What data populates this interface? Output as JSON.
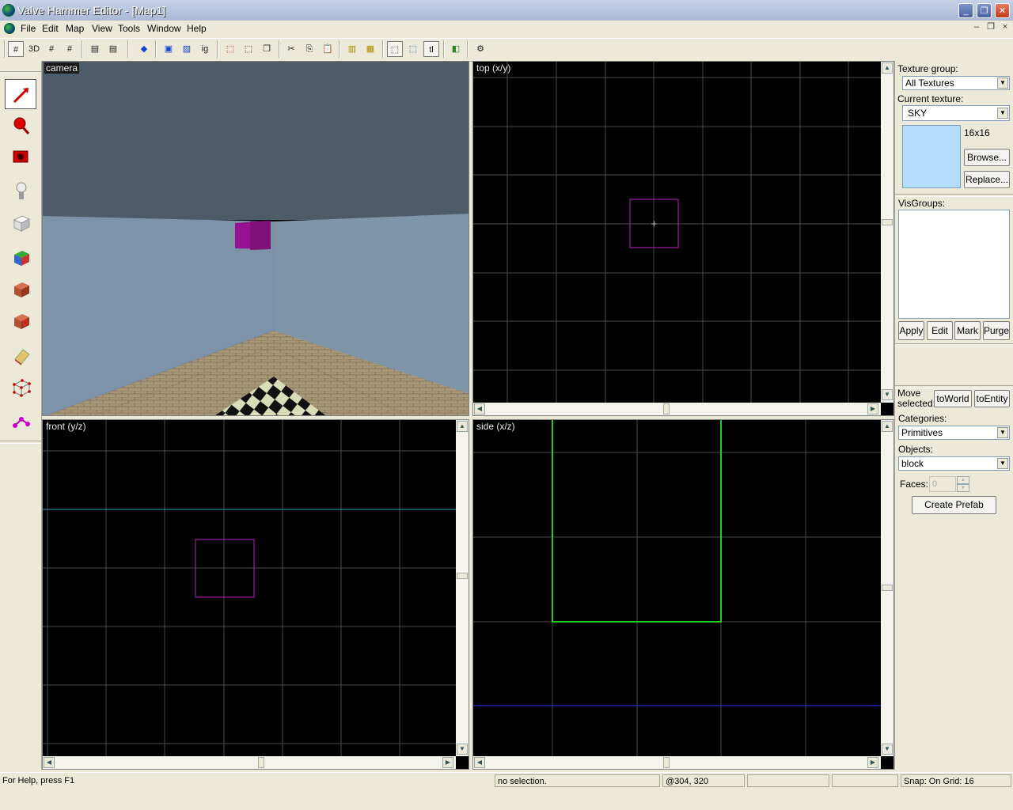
{
  "window": {
    "title": "Valve Hammer Editor - [Map1]",
    "minimize_glyph": "_",
    "restore_glyph": "❐",
    "close_glyph": "✕"
  },
  "menu": [
    "File",
    "Edit",
    "Map",
    "View",
    "Tools",
    "Window",
    "Help"
  ],
  "mdi_controls": [
    "–",
    "❐",
    "×"
  ],
  "toolbar": {
    "texture_lock_label": "tl",
    "group_ignore_label": "ig"
  },
  "viewports": {
    "camera": {
      "label": "camera"
    },
    "top": {
      "label": "top (x/y)"
    },
    "front": {
      "label": "front (y/z)"
    },
    "side": {
      "label": "side (x/z)"
    }
  },
  "right_panel": {
    "texture_group_label": "Texture group:",
    "texture_group_value": "All Textures",
    "current_texture_label": "Current texture:",
    "current_texture_value": "SKY",
    "texture_size": "16x16",
    "texture_preview_color": "#b6dcff",
    "browse": "Browse...",
    "replace": "Replace...",
    "visgroups_label": "VisGroups:",
    "apply": "Apply",
    "edit": "Edit",
    "mark": "Mark",
    "purge": "Purge",
    "move_selected": "Move selected:",
    "to_world": "toWorld",
    "to_entity": "toEntity",
    "categories_label": "Categories:",
    "categories_value": "Primitives",
    "objects_label": "Objects:",
    "objects_value": "block",
    "faces_label": "Faces:",
    "faces_value": "0",
    "create_prefab": "Create Prefab"
  },
  "status": {
    "help": "For Help, press F1",
    "selection": "no selection.",
    "coords": "@304, 320",
    "snap": "Snap: On Grid: 16"
  },
  "colors": {
    "selection_box": "#c020c0",
    "brush_green": "#20d020",
    "axis_cyan": "#30a0c0",
    "axis_blue": "#3030ff",
    "grid": "#505050"
  },
  "tools": [
    "selection-tool-icon",
    "magnify-tool-icon",
    "camera-tool-icon",
    "entity-tool-icon",
    "block-tool-icon",
    "texture-application-icon",
    "apply-current-texture-icon",
    "decal-tool-icon",
    "clipping-tool-icon",
    "vertex-manipulation-icon",
    "path-tool-icon"
  ]
}
